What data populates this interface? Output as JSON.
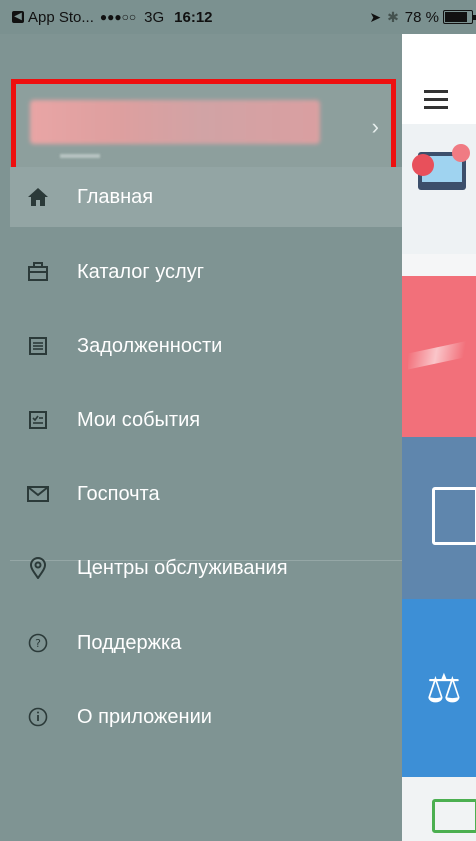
{
  "status_bar": {
    "back_app": "App Sto...",
    "signal": "●●●○○",
    "network": "3G",
    "time": "16:12",
    "battery": "78 %",
    "battery_level": 0.78
  },
  "profile": {
    "chevron": "›"
  },
  "menu": {
    "items": [
      {
        "label": "Главная",
        "icon": "home-icon"
      },
      {
        "label": "Каталог услуг",
        "icon": "catalog-icon"
      },
      {
        "label": "Задолженности",
        "icon": "debts-icon"
      },
      {
        "label": "Мои события",
        "icon": "events-icon"
      },
      {
        "label": "Госпочта",
        "icon": "mail-icon"
      },
      {
        "label": "Центры обслуживания",
        "icon": "location-icon"
      },
      {
        "label": "Поддержка",
        "icon": "help-icon"
      },
      {
        "label": "О приложении",
        "icon": "info-icon"
      }
    ]
  },
  "colors": {
    "drawer_bg": "#7f9493",
    "highlight": "#ee0f0f",
    "tile_red": "#f2707a",
    "tile_slate": "#5f86ad",
    "tile_blue": "#3d8fd6"
  }
}
